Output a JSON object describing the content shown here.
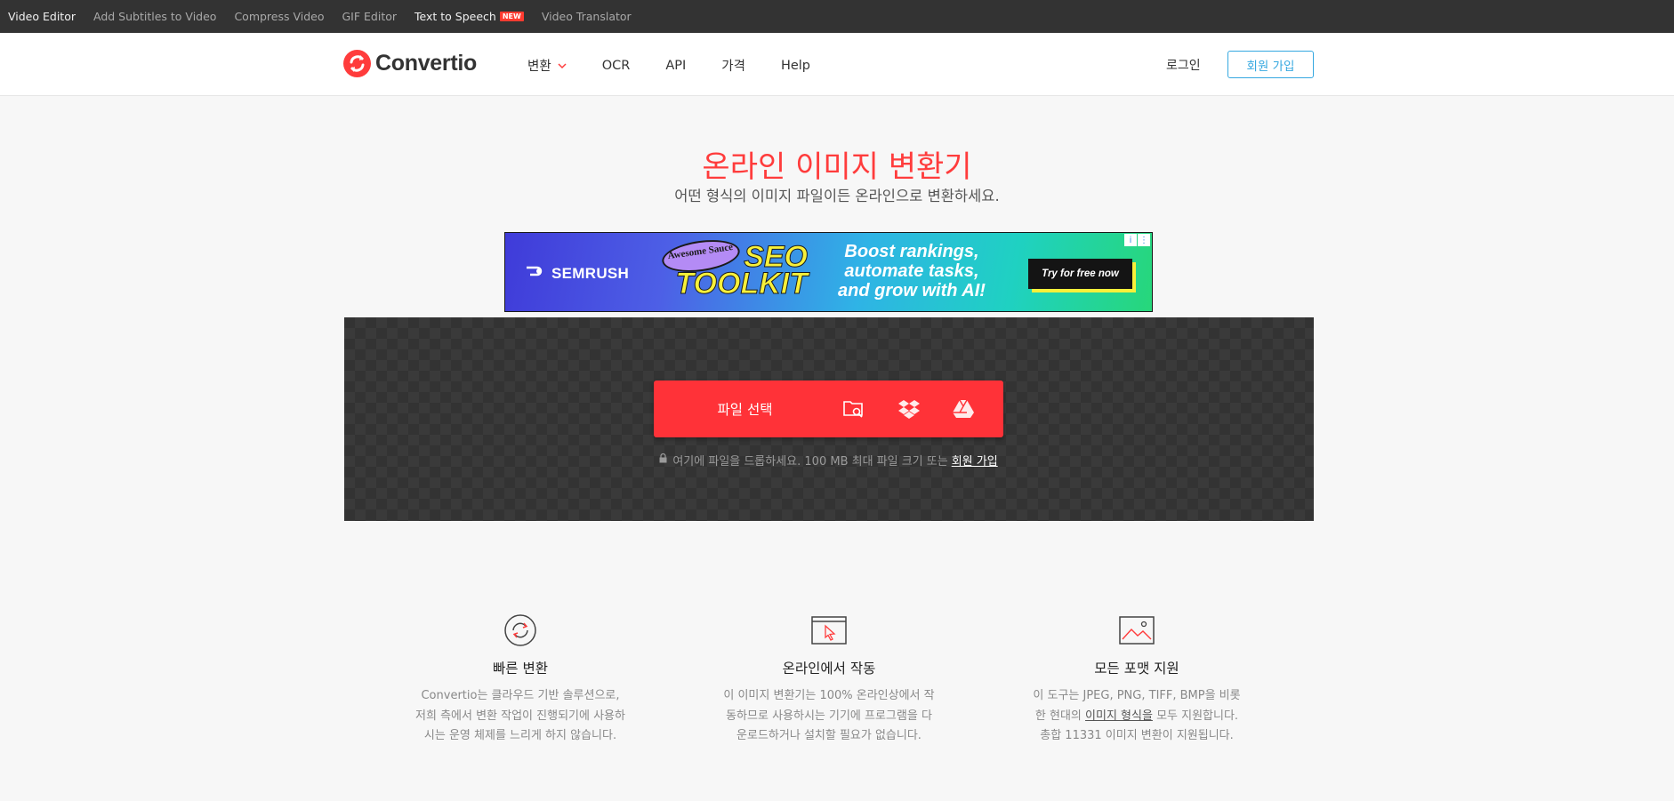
{
  "topbar": {
    "links": [
      {
        "label": "Video Editor"
      },
      {
        "label": "Add Subtitles to Video"
      },
      {
        "label": "Compress Video"
      },
      {
        "label": "GIF Editor"
      },
      {
        "label": "Text to Speech",
        "badge": "NEW"
      },
      {
        "label": "Video Translator"
      }
    ]
  },
  "header": {
    "logo_text": "Convertio",
    "nav": [
      {
        "label": "변환",
        "icon": "chevron-down-icon"
      },
      {
        "label": "OCR"
      },
      {
        "label": "API"
      },
      {
        "label": "가격"
      },
      {
        "label": "Help"
      }
    ],
    "login_label": "로그인",
    "signup_label": "회원 가입"
  },
  "hero": {
    "title": "온라인 이미지 변환기",
    "subtitle": "어떤 형식의 이미지 파일이든 온라인으로 변환하세요."
  },
  "ad": {
    "brand": "SEMRUSH",
    "sauce": "Awesome Sauce",
    "headline_1": "SEO",
    "headline_2": "TOOLKIT",
    "copy": "Boost rankings, automate tasks, and grow with AI!",
    "cta": "Try for free now",
    "info_icon": "i",
    "menu_icon": "⋮"
  },
  "dropzone": {
    "choose_label": "파일 선택",
    "icons": [
      "folder-search-icon",
      "dropbox-icon",
      "google-drive-icon"
    ],
    "note_text": "여기에 파일을 드롭하세요. 100 MB 최대 파일 크기 또는",
    "note_link": "회원 가입"
  },
  "features": [
    {
      "icon": "refresh-icon",
      "title": "빠른 변환",
      "text": "Convertio는 클라우드 기반 솔루션으로, 저희 측에서 변환 작업이 진행되기에 사용하시는 운영 체제를 느리게 하지 않습니다."
    },
    {
      "icon": "browser-cursor-icon",
      "title": "온라인에서 작동",
      "text": "이 이미지 변환기는 100% 온라인상에서 작동하므로 사용하시는 기기에 프로그램을 다운로드하거나 설치할 필요가 없습니다."
    },
    {
      "icon": "image-icon",
      "title": "모든 포맷 지원",
      "text_before": "이 도구는 JPEG, PNG, TIFF, BMP을 비롯한 현대의",
      "text_link": "이미지 형식을",
      "text_after": "모두 지원합니다. 총합 11331 이미지 변환이 지원됩니다."
    }
  ],
  "colors": {
    "brand_red": "#ff3c3c",
    "signup_blue": "#35a8e0",
    "topbar_bg": "#333333"
  }
}
